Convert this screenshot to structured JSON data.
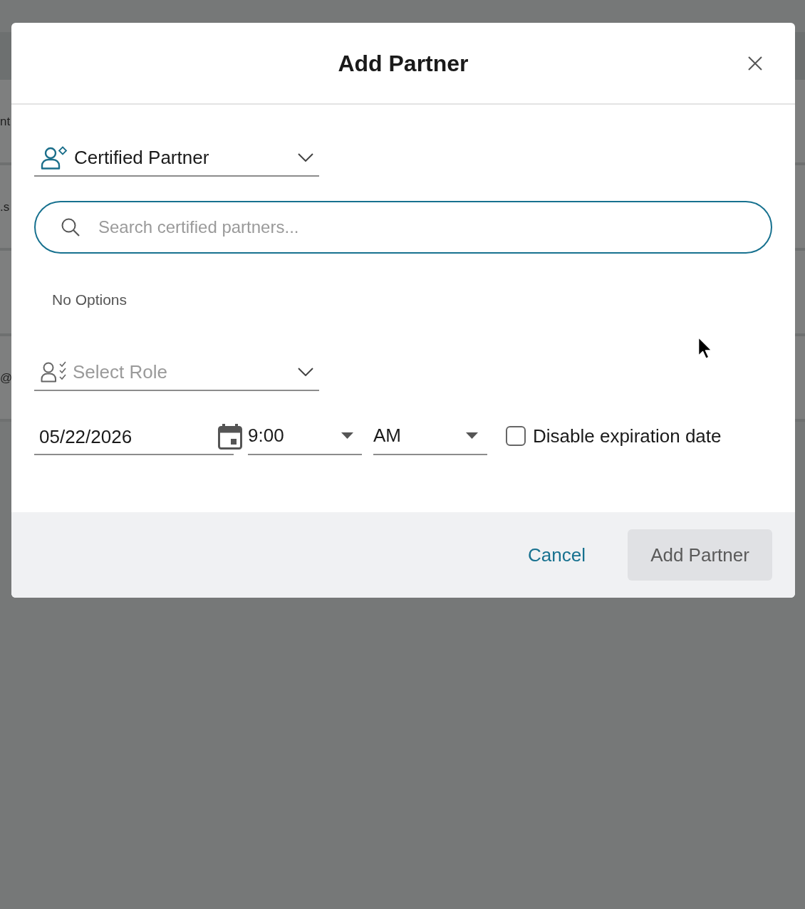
{
  "background_page": {
    "rows": [
      {
        "fragment": "nt"
      },
      {
        "fragment": ".s"
      },
      {},
      {
        "fragment": "@"
      }
    ]
  },
  "dialog": {
    "title": "Add Partner",
    "partner_type_select": {
      "value": "Certified Partner"
    },
    "search": {
      "placeholder": "Search certified partners..."
    },
    "results": {
      "empty_text": "No Options"
    },
    "role_select": {
      "placeholder": "Select Role"
    },
    "expiration": {
      "date": "05/22/2026",
      "time": "9:00",
      "period": "AM",
      "disable_expiration": {
        "label": "Disable expiration date",
        "checked": false
      }
    },
    "buttons": [
      {
        "label": "Cancel",
        "kind": "text",
        "disabled": false
      },
      {
        "label": "Add Partner",
        "kind": "filled",
        "disabled": true
      }
    ]
  }
}
